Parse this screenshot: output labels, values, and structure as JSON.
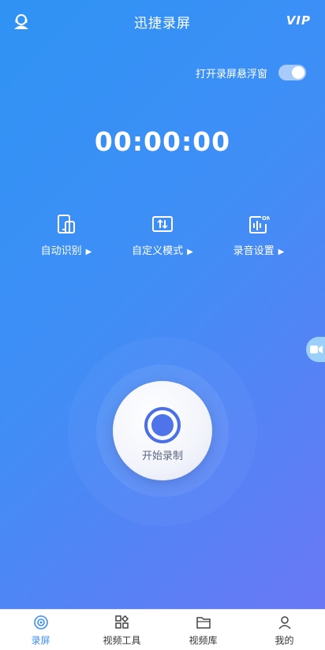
{
  "header": {
    "title": "迅捷录屏",
    "vip_label": "VIP"
  },
  "floating_window": {
    "label": "打开录屏悬浮窗",
    "enabled": true
  },
  "timer": "00:00:00",
  "options": [
    {
      "label": "自动识别",
      "icon": "phone-rotate-icon"
    },
    {
      "label": "自定义模式",
      "icon": "custom-mode-icon"
    },
    {
      "label": "录音设置",
      "icon": "audio-on-icon",
      "badge": "ON"
    }
  ],
  "arrow_glyph": "▶",
  "record_button": {
    "label": "开始录制"
  },
  "nav": {
    "items": [
      {
        "label": "录屏",
        "icon": "record-disc-icon",
        "active": true
      },
      {
        "label": "视频工具",
        "icon": "tools-grid-icon",
        "active": false
      },
      {
        "label": "视频库",
        "icon": "folder-icon",
        "active": false
      },
      {
        "label": "我的",
        "icon": "person-icon",
        "active": false
      }
    ]
  },
  "colors": {
    "gradient_start": "#2f93f4",
    "gradient_end": "#6a78f5",
    "accent": "#3b8ef5",
    "record_ring": "#4a6fe6"
  }
}
